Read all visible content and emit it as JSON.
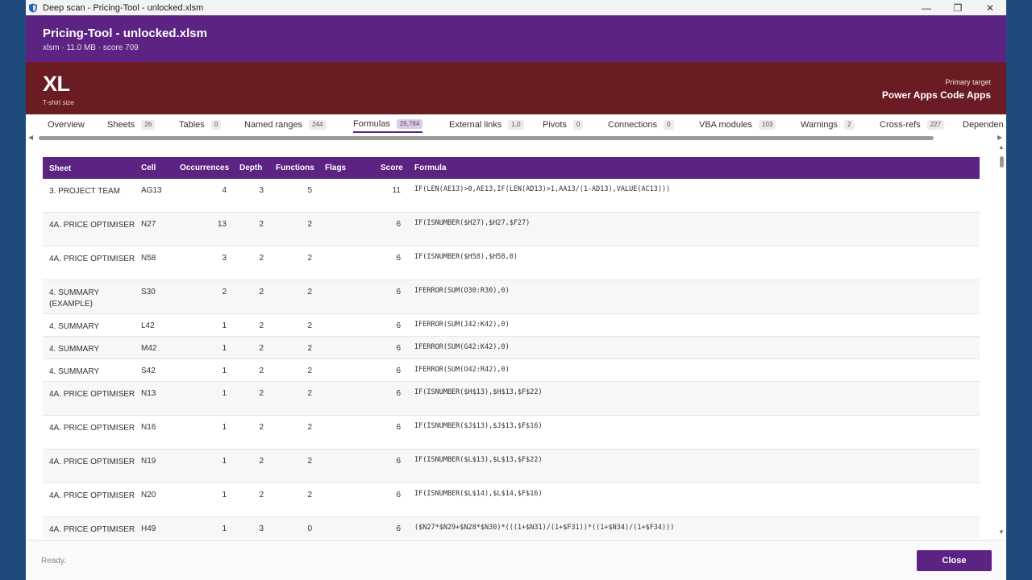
{
  "window": {
    "title": "Deep scan - Pricing-Tool - unlocked.xlsm",
    "minimize": "—",
    "restore": "❐",
    "close": "✕"
  },
  "header": {
    "title": "Pricing-Tool - unlocked.xlsm",
    "subtitle": "xlsm · 11.0 MB · score 709"
  },
  "banner": {
    "size": "XL",
    "size_label": "T-shirt size",
    "target_label": "Primary target",
    "target_value": "Power Apps Code Apps",
    "color": "#6b1c22"
  },
  "accent": "#5c2382",
  "tabs": [
    {
      "label": "Overview",
      "count": ""
    },
    {
      "label": "Sheets",
      "count": "26"
    },
    {
      "label": "Tables",
      "count": "0"
    },
    {
      "label": "Named ranges",
      "count": "244"
    },
    {
      "label": "Formulas",
      "count": "26,784"
    },
    {
      "label": "External links",
      "count": "1,0"
    },
    {
      "label": "Pivots",
      "count": "0"
    },
    {
      "label": "Connections",
      "count": "0"
    },
    {
      "label": "VBA modules",
      "count": "103"
    },
    {
      "label": "Warnings",
      "count": "2"
    },
    {
      "label": "Cross-refs",
      "count": "227"
    },
    {
      "label": "Dependen",
      "count": ""
    }
  ],
  "columns": {
    "sheet": "Sheet",
    "cell": "Cell",
    "occurrences": "Occurrences",
    "depth": "Depth",
    "functions": "Functions",
    "flags": "Flags",
    "score": "Score",
    "formula": "Formula"
  },
  "rows": [
    {
      "sheet": "3. PROJECT TEAM",
      "cell": "AG13",
      "occurrences": "4",
      "depth": "3",
      "functions": "5",
      "flags": "",
      "score": "11",
      "formula": "IF(LEN(AE13)>0,AE13,IF(LEN(AD13)>1,AA13/(1-AD13),VALUE(AC13)))"
    },
    {
      "sheet": "4A. PRICE OPTIMISER",
      "cell": "N27",
      "occurrences": "13",
      "depth": "2",
      "functions": "2",
      "flags": "",
      "score": "6",
      "formula": "IF(ISNUMBER($H27),$H27,$F27)"
    },
    {
      "sheet": "4A. PRICE OPTIMISER",
      "cell": "N58",
      "occurrences": "3",
      "depth": "2",
      "functions": "2",
      "flags": "",
      "score": "6",
      "formula": "IF(ISNUMBER($H58),$H58,0)"
    },
    {
      "sheet": "4. SUMMARY (EXAMPLE)",
      "cell": "S30",
      "occurrences": "2",
      "depth": "2",
      "functions": "2",
      "flags": "",
      "score": "6",
      "formula": "IFERROR(SUM(O30:R30),0)"
    },
    {
      "sheet": "4. SUMMARY",
      "cell": "L42",
      "occurrences": "1",
      "depth": "2",
      "functions": "2",
      "flags": "",
      "score": "6",
      "formula": "IFERROR(SUM(J42:K42),0)"
    },
    {
      "sheet": "4. SUMMARY",
      "cell": "M42",
      "occurrences": "1",
      "depth": "2",
      "functions": "2",
      "flags": "",
      "score": "6",
      "formula": "IFERROR(SUM(G42:K42),0)"
    },
    {
      "sheet": "4. SUMMARY",
      "cell": "S42",
      "occurrences": "1",
      "depth": "2",
      "functions": "2",
      "flags": "",
      "score": "6",
      "formula": "IFERROR(SUM(O42:R42),0)"
    },
    {
      "sheet": "4A. PRICE OPTIMISER",
      "cell": "N13",
      "occurrences": "1",
      "depth": "2",
      "functions": "2",
      "flags": "",
      "score": "6",
      "formula": "IF(ISNUMBER($H$13),$H$13,$F$22)"
    },
    {
      "sheet": "4A. PRICE OPTIMISER",
      "cell": "N16",
      "occurrences": "1",
      "depth": "2",
      "functions": "2",
      "flags": "",
      "score": "6",
      "formula": "IF(ISNUMBER($J$13),$J$13,$F$16)"
    },
    {
      "sheet": "4A. PRICE OPTIMISER",
      "cell": "N19",
      "occurrences": "1",
      "depth": "2",
      "functions": "2",
      "flags": "",
      "score": "6",
      "formula": "IF(ISNUMBER($L$13),$L$13,$F$22)"
    },
    {
      "sheet": "4A. PRICE OPTIMISER",
      "cell": "N20",
      "occurrences": "1",
      "depth": "2",
      "functions": "2",
      "flags": "",
      "score": "6",
      "formula": "IF(ISNUMBER($L$14),$L$14,$F$16)"
    },
    {
      "sheet": "4A. PRICE OPTIMISER",
      "cell": "H49",
      "occurrences": "1",
      "depth": "3",
      "functions": "0",
      "flags": "",
      "score": "6",
      "formula": "($N27*$N29+$N28*$N30)*(((1+$N31)/(1+$F31))*((1+$N34)/(1+$F34)))"
    }
  ],
  "footer": {
    "status": "Ready.",
    "close_label": "Close"
  }
}
